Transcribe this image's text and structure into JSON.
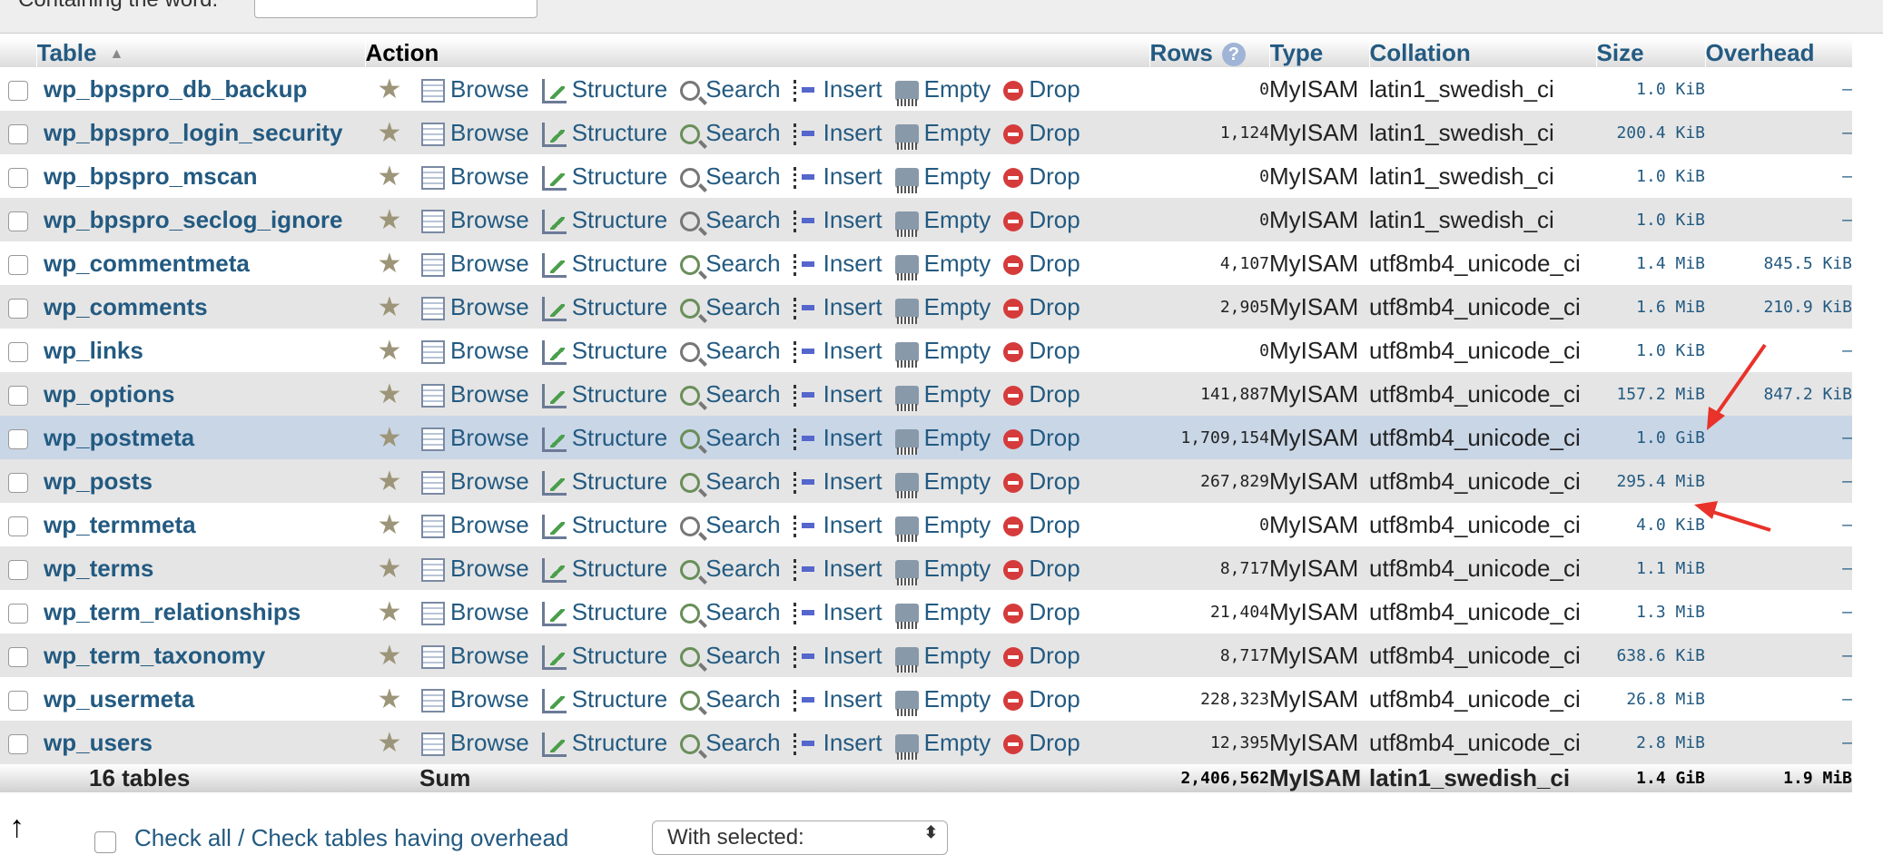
{
  "filter": {
    "label": "Containing the word:"
  },
  "headers": {
    "table": "Table",
    "action": "Action",
    "rows": "Rows",
    "type": "Type",
    "collation": "Collation",
    "size": "Size",
    "overhead": "Overhead"
  },
  "actions": {
    "browse": "Browse",
    "structure": "Structure",
    "search": "Search",
    "insert": "Insert",
    "empty": "Empty",
    "drop": "Drop"
  },
  "tables": [
    {
      "name": "wp_bpspro_db_backup",
      "rows": "0",
      "type": "MyISAM",
      "collation": "latin1_swedish_ci",
      "size": "1.0 KiB",
      "overhead": "–"
    },
    {
      "name": "wp_bpspro_login_security",
      "rows": "1,124",
      "type": "MyISAM",
      "collation": "latin1_swedish_ci",
      "size": "200.4 KiB",
      "overhead": "–"
    },
    {
      "name": "wp_bpspro_mscan",
      "rows": "0",
      "type": "MyISAM",
      "collation": "latin1_swedish_ci",
      "size": "1.0 KiB",
      "overhead": "–"
    },
    {
      "name": "wp_bpspro_seclog_ignore",
      "rows": "0",
      "type": "MyISAM",
      "collation": "latin1_swedish_ci",
      "size": "1.0 KiB",
      "overhead": "–"
    },
    {
      "name": "wp_commentmeta",
      "rows": "4,107",
      "type": "MyISAM",
      "collation": "utf8mb4_unicode_ci",
      "size": "1.4 MiB",
      "overhead": "845.5 KiB"
    },
    {
      "name": "wp_comments",
      "rows": "2,905",
      "type": "MyISAM",
      "collation": "utf8mb4_unicode_ci",
      "size": "1.6 MiB",
      "overhead": "210.9 KiB"
    },
    {
      "name": "wp_links",
      "rows": "0",
      "type": "MyISAM",
      "collation": "utf8mb4_unicode_ci",
      "size": "1.0 KiB",
      "overhead": "–"
    },
    {
      "name": "wp_options",
      "rows": "141,887",
      "type": "MyISAM",
      "collation": "utf8mb4_unicode_ci",
      "size": "157.2 MiB",
      "overhead": "847.2 KiB"
    },
    {
      "name": "wp_postmeta",
      "rows": "1,709,154",
      "type": "MyISAM",
      "collation": "utf8mb4_unicode_ci",
      "size": "1.0 GiB",
      "overhead": "–"
    },
    {
      "name": "wp_posts",
      "rows": "267,829",
      "type": "MyISAM",
      "collation": "utf8mb4_unicode_ci",
      "size": "295.4 MiB",
      "overhead": "–"
    },
    {
      "name": "wp_termmeta",
      "rows": "0",
      "type": "MyISAM",
      "collation": "utf8mb4_unicode_ci",
      "size": "4.0 KiB",
      "overhead": "–"
    },
    {
      "name": "wp_terms",
      "rows": "8,717",
      "type": "MyISAM",
      "collation": "utf8mb4_unicode_ci",
      "size": "1.1 MiB",
      "overhead": "–"
    },
    {
      "name": "wp_term_relationships",
      "rows": "21,404",
      "type": "MyISAM",
      "collation": "utf8mb4_unicode_ci",
      "size": "1.3 MiB",
      "overhead": "–"
    },
    {
      "name": "wp_term_taxonomy",
      "rows": "8,717",
      "type": "MyISAM",
      "collation": "utf8mb4_unicode_ci",
      "size": "638.6 KiB",
      "overhead": "–"
    },
    {
      "name": "wp_usermeta",
      "rows": "228,323",
      "type": "MyISAM",
      "collation": "utf8mb4_unicode_ci",
      "size": "26.8 MiB",
      "overhead": "–"
    },
    {
      "name": "wp_users",
      "rows": "12,395",
      "type": "MyISAM",
      "collation": "utf8mb4_unicode_ci",
      "size": "2.8 MiB",
      "overhead": "–"
    }
  ],
  "footer": {
    "count": "16 tables",
    "sum": "Sum",
    "rows": "2,406,562",
    "type": "MyISAM",
    "collation": "latin1_swedish_ci",
    "size": "1.4 GiB",
    "overhead": "1.9 MiB"
  },
  "bottom": {
    "check_all": "Check all",
    "separator": " / ",
    "check_overhead": "Check tables having overhead",
    "with_selected": "With selected:"
  },
  "colors": {
    "link": "#235a81",
    "annotation": "#e8322a",
    "marked_row": "#c9d6e6"
  }
}
